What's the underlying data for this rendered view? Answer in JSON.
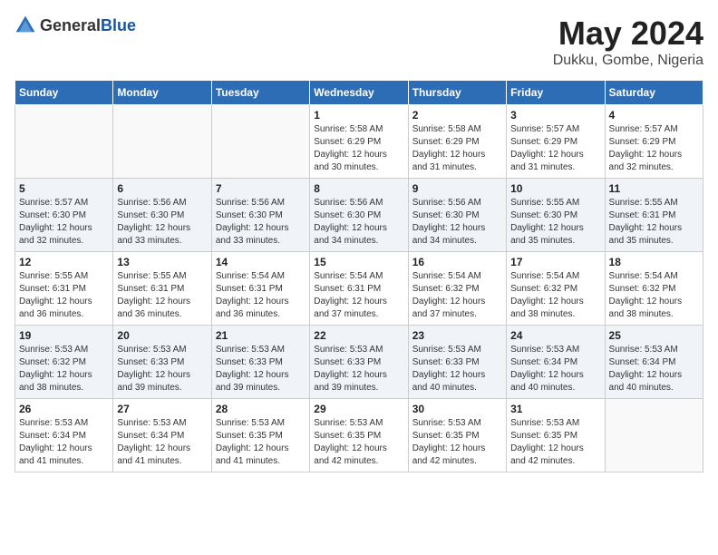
{
  "header": {
    "logo_general": "General",
    "logo_blue": "Blue",
    "month_year": "May 2024",
    "location": "Dukku, Gombe, Nigeria"
  },
  "weekdays": [
    "Sunday",
    "Monday",
    "Tuesday",
    "Wednesday",
    "Thursday",
    "Friday",
    "Saturday"
  ],
  "weeks": [
    [
      {
        "day": "",
        "info": ""
      },
      {
        "day": "",
        "info": ""
      },
      {
        "day": "",
        "info": ""
      },
      {
        "day": "1",
        "info": "Sunrise: 5:58 AM\nSunset: 6:29 PM\nDaylight: 12 hours\nand 30 minutes."
      },
      {
        "day": "2",
        "info": "Sunrise: 5:58 AM\nSunset: 6:29 PM\nDaylight: 12 hours\nand 31 minutes."
      },
      {
        "day": "3",
        "info": "Sunrise: 5:57 AM\nSunset: 6:29 PM\nDaylight: 12 hours\nand 31 minutes."
      },
      {
        "day": "4",
        "info": "Sunrise: 5:57 AM\nSunset: 6:29 PM\nDaylight: 12 hours\nand 32 minutes."
      }
    ],
    [
      {
        "day": "5",
        "info": "Sunrise: 5:57 AM\nSunset: 6:30 PM\nDaylight: 12 hours\nand 32 minutes."
      },
      {
        "day": "6",
        "info": "Sunrise: 5:56 AM\nSunset: 6:30 PM\nDaylight: 12 hours\nand 33 minutes."
      },
      {
        "day": "7",
        "info": "Sunrise: 5:56 AM\nSunset: 6:30 PM\nDaylight: 12 hours\nand 33 minutes."
      },
      {
        "day": "8",
        "info": "Sunrise: 5:56 AM\nSunset: 6:30 PM\nDaylight: 12 hours\nand 34 minutes."
      },
      {
        "day": "9",
        "info": "Sunrise: 5:56 AM\nSunset: 6:30 PM\nDaylight: 12 hours\nand 34 minutes."
      },
      {
        "day": "10",
        "info": "Sunrise: 5:55 AM\nSunset: 6:30 PM\nDaylight: 12 hours\nand 35 minutes."
      },
      {
        "day": "11",
        "info": "Sunrise: 5:55 AM\nSunset: 6:31 PM\nDaylight: 12 hours\nand 35 minutes."
      }
    ],
    [
      {
        "day": "12",
        "info": "Sunrise: 5:55 AM\nSunset: 6:31 PM\nDaylight: 12 hours\nand 36 minutes."
      },
      {
        "day": "13",
        "info": "Sunrise: 5:55 AM\nSunset: 6:31 PM\nDaylight: 12 hours\nand 36 minutes."
      },
      {
        "day": "14",
        "info": "Sunrise: 5:54 AM\nSunset: 6:31 PM\nDaylight: 12 hours\nand 36 minutes."
      },
      {
        "day": "15",
        "info": "Sunrise: 5:54 AM\nSunset: 6:31 PM\nDaylight: 12 hours\nand 37 minutes."
      },
      {
        "day": "16",
        "info": "Sunrise: 5:54 AM\nSunset: 6:32 PM\nDaylight: 12 hours\nand 37 minutes."
      },
      {
        "day": "17",
        "info": "Sunrise: 5:54 AM\nSunset: 6:32 PM\nDaylight: 12 hours\nand 38 minutes."
      },
      {
        "day": "18",
        "info": "Sunrise: 5:54 AM\nSunset: 6:32 PM\nDaylight: 12 hours\nand 38 minutes."
      }
    ],
    [
      {
        "day": "19",
        "info": "Sunrise: 5:53 AM\nSunset: 6:32 PM\nDaylight: 12 hours\nand 38 minutes."
      },
      {
        "day": "20",
        "info": "Sunrise: 5:53 AM\nSunset: 6:33 PM\nDaylight: 12 hours\nand 39 minutes."
      },
      {
        "day": "21",
        "info": "Sunrise: 5:53 AM\nSunset: 6:33 PM\nDaylight: 12 hours\nand 39 minutes."
      },
      {
        "day": "22",
        "info": "Sunrise: 5:53 AM\nSunset: 6:33 PM\nDaylight: 12 hours\nand 39 minutes."
      },
      {
        "day": "23",
        "info": "Sunrise: 5:53 AM\nSunset: 6:33 PM\nDaylight: 12 hours\nand 40 minutes."
      },
      {
        "day": "24",
        "info": "Sunrise: 5:53 AM\nSunset: 6:34 PM\nDaylight: 12 hours\nand 40 minutes."
      },
      {
        "day": "25",
        "info": "Sunrise: 5:53 AM\nSunset: 6:34 PM\nDaylight: 12 hours\nand 40 minutes."
      }
    ],
    [
      {
        "day": "26",
        "info": "Sunrise: 5:53 AM\nSunset: 6:34 PM\nDaylight: 12 hours\nand 41 minutes."
      },
      {
        "day": "27",
        "info": "Sunrise: 5:53 AM\nSunset: 6:34 PM\nDaylight: 12 hours\nand 41 minutes."
      },
      {
        "day": "28",
        "info": "Sunrise: 5:53 AM\nSunset: 6:35 PM\nDaylight: 12 hours\nand 41 minutes."
      },
      {
        "day": "29",
        "info": "Sunrise: 5:53 AM\nSunset: 6:35 PM\nDaylight: 12 hours\nand 42 minutes."
      },
      {
        "day": "30",
        "info": "Sunrise: 5:53 AM\nSunset: 6:35 PM\nDaylight: 12 hours\nand 42 minutes."
      },
      {
        "day": "31",
        "info": "Sunrise: 5:53 AM\nSunset: 6:35 PM\nDaylight: 12 hours\nand 42 minutes."
      },
      {
        "day": "",
        "info": ""
      }
    ]
  ]
}
